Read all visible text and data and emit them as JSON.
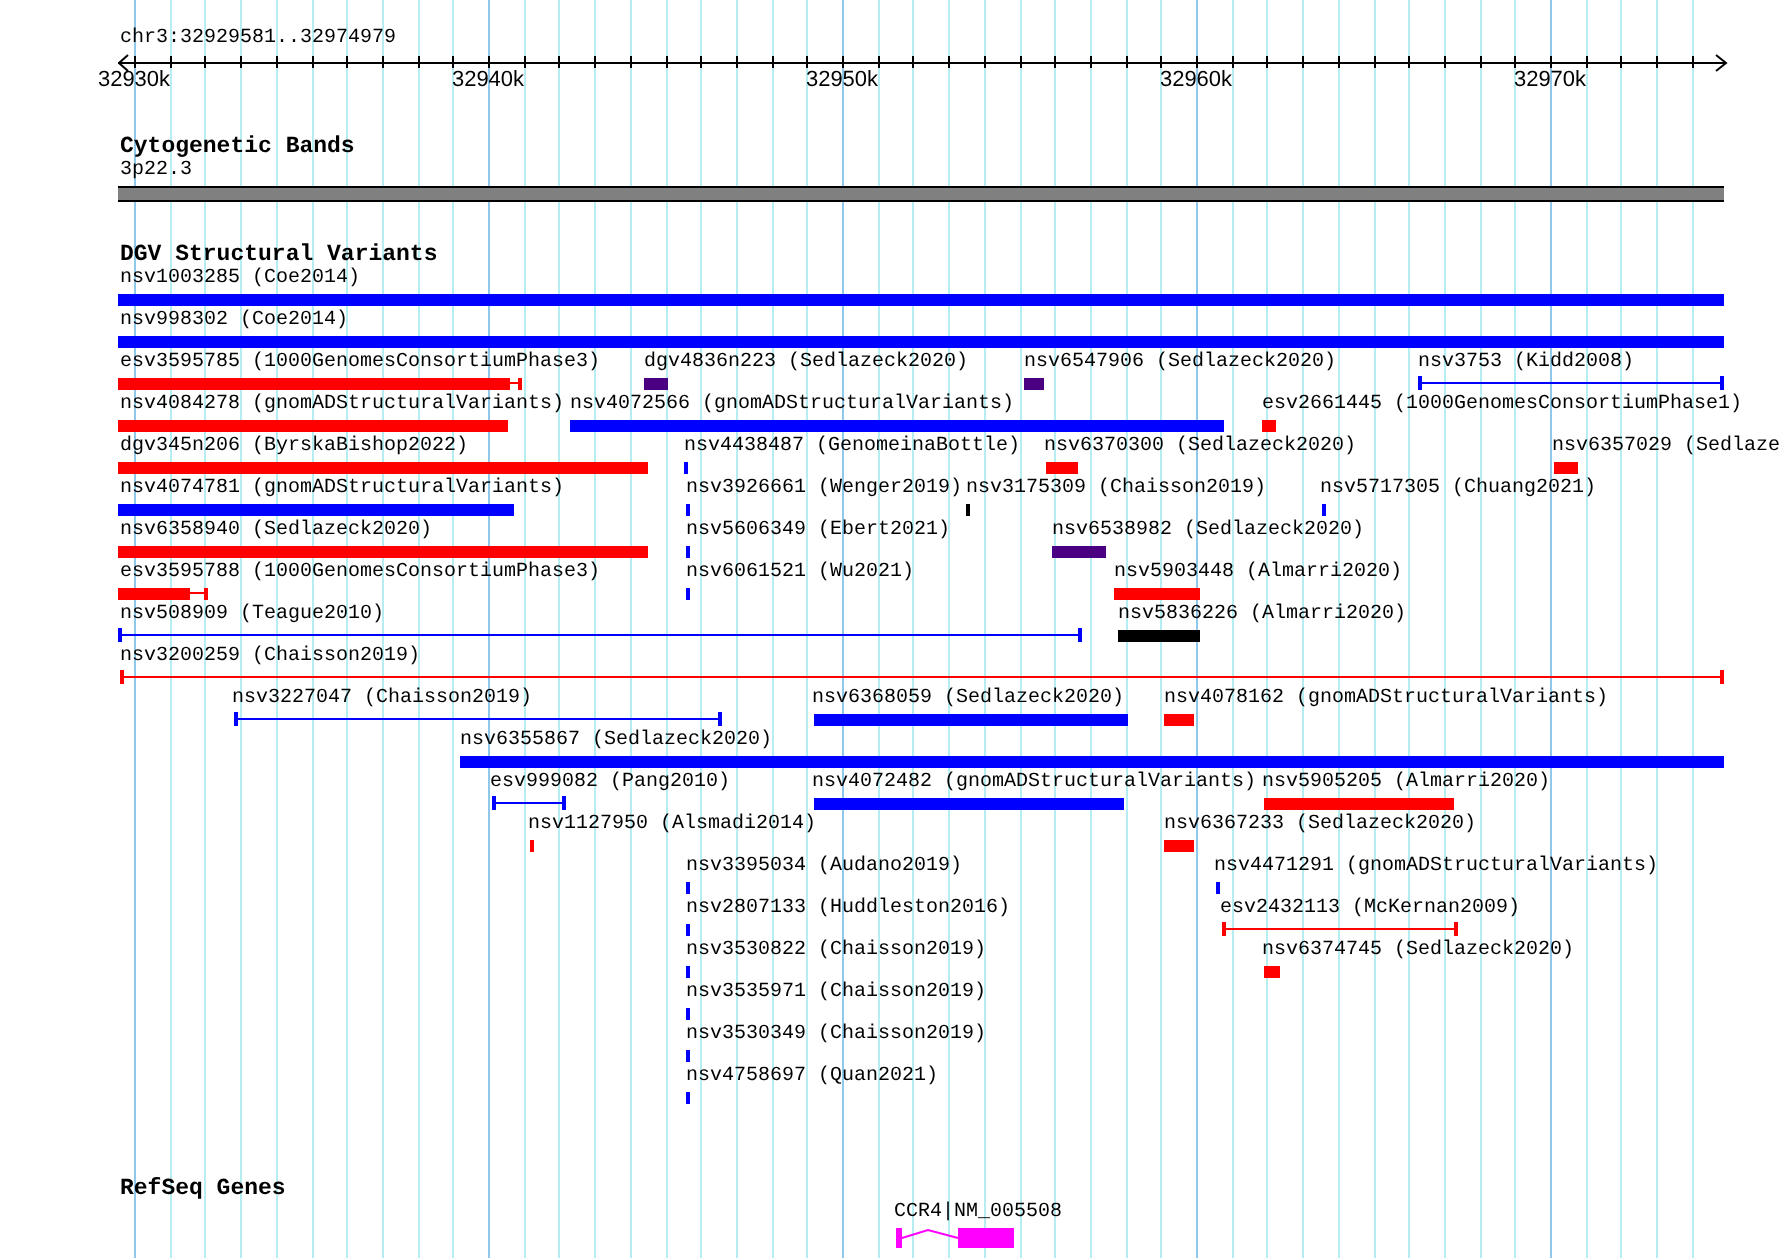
{
  "ruler": {
    "location": "chr3:32929581..32974979",
    "tick_labels": [
      "32930k",
      "32940k",
      "32950k",
      "32960k",
      "32970k"
    ]
  },
  "cytoband_track": {
    "title": "Cytogenetic Bands",
    "band_label": "3p22.3"
  },
  "variant_track": {
    "title": "DGV Structural Variants",
    "lanes": [
      {
        "features": [
          {
            "label": "nsv1003285 (Coe2014)",
            "color": "#0000ff",
            "kind": "bar"
          }
        ]
      },
      {
        "features": [
          {
            "label": "nsv998302 (Coe2014)",
            "color": "#0000ff",
            "kind": "bar"
          }
        ]
      },
      {
        "features": [
          {
            "label": "esv3595785 (1000GenomesConsortiumPhase3)",
            "color": "#ff0000",
            "kind": "bar_tail"
          },
          {
            "label": "dgv4836n223 (Sedlazeck2020)",
            "color": "#4b0082",
            "kind": "bar"
          },
          {
            "label": "nsv6547906 (Sedlazeck2020)",
            "color": "#4b0082",
            "kind": "bar"
          },
          {
            "label": "nsv3753 (Kidd2008)",
            "color": "#0000ff",
            "kind": "span"
          }
        ]
      },
      {
        "features": [
          {
            "label": "nsv4084278 (gnomADStructuralVariants)",
            "color": "#ff0000",
            "kind": "bar"
          },
          {
            "label": "nsv4072566 (gnomADStructuralVariants)",
            "color": "#0000ff",
            "kind": "bar"
          },
          {
            "label": "esv2661445 (1000GenomesConsortiumPhase1)",
            "color": "#ff0000",
            "kind": "bar"
          }
        ]
      },
      {
        "features": [
          {
            "label": "dgv345n206 (ByrskaBishop2022)",
            "color": "#ff0000",
            "kind": "bar"
          },
          {
            "label": "nsv4438487 (GenomeinaBottle)",
            "color": "#0000ff",
            "kind": "bar"
          },
          {
            "label": "nsv6370300 (Sedlazeck2020)",
            "color": "#ff0000",
            "kind": "bar"
          },
          {
            "label": "nsv6357029 (Sedlaze",
            "color": "#ff0000",
            "kind": "bar"
          }
        ]
      },
      {
        "features": [
          {
            "label": "nsv4074781 (gnomADStructuralVariants)",
            "color": "#0000ff",
            "kind": "bar"
          },
          {
            "label": "nsv3926661 (Wenger2019)",
            "color": "#0000ff",
            "kind": "bar"
          },
          {
            "label": "nsv3175309 (Chaisson2019)",
            "color": "#000000",
            "kind": "bar"
          },
          {
            "label": "nsv5717305 (Chuang2021)",
            "color": "#0000ff",
            "kind": "bar"
          }
        ]
      },
      {
        "features": [
          {
            "label": "nsv6358940 (Sedlazeck2020)",
            "color": "#ff0000",
            "kind": "bar"
          },
          {
            "label": "nsv5606349 (Ebert2021)",
            "color": "#0000ff",
            "kind": "bar"
          },
          {
            "label": "nsv6538982 (Sedlazeck2020)",
            "color": "#4b0082",
            "kind": "bar"
          }
        ]
      },
      {
        "features": [
          {
            "label": "esv3595788 (1000GenomesConsortiumPhase3)",
            "color": "#ff0000",
            "kind": "bar_tail"
          },
          {
            "label": "nsv6061521 (Wu2021)",
            "color": "#0000ff",
            "kind": "bar"
          },
          {
            "label": "nsv5903448 (Almarri2020)",
            "color": "#ff0000",
            "kind": "bar"
          }
        ]
      },
      {
        "features": [
          {
            "label": "nsv508909 (Teague2010)",
            "color": "#0000ff",
            "kind": "span"
          },
          {
            "label": "nsv5836226 (Almarri2020)",
            "color": "#000000",
            "kind": "bar"
          }
        ]
      },
      {
        "features": [
          {
            "label": "nsv3200259 (Chaisson2019)",
            "color": "#ff0000",
            "kind": "span"
          }
        ]
      },
      {
        "features": [
          {
            "label": "nsv3227047 (Chaisson2019)",
            "color": "#0000ff",
            "kind": "span"
          },
          {
            "label": "nsv6368059 (Sedlazeck2020)",
            "color": "#0000ff",
            "kind": "bar"
          },
          {
            "label": "nsv4078162 (gnomADStructuralVariants)",
            "color": "#ff0000",
            "kind": "bar"
          }
        ]
      },
      {
        "features": [
          {
            "label": "nsv6355867 (Sedlazeck2020)",
            "color": "#0000ff",
            "kind": "bar"
          }
        ]
      },
      {
        "features": [
          {
            "label": "esv999082 (Pang2010)",
            "color": "#0000ff",
            "kind": "span"
          },
          {
            "label": "nsv4072482 (gnomADStructuralVariants)",
            "color": "#0000ff",
            "kind": "bar"
          },
          {
            "label": "nsv5905205 (Almarri2020)",
            "color": "#ff0000",
            "kind": "bar"
          }
        ]
      },
      {
        "features": [
          {
            "label": "nsv1127950 (Alsmadi2014)",
            "color": "#ff0000",
            "kind": "bar"
          },
          {
            "label": "nsv6367233 (Sedlazeck2020)",
            "color": "#ff0000",
            "kind": "bar"
          }
        ]
      },
      {
        "features": [
          {
            "label": "nsv3395034 (Audano2019)",
            "color": "#0000ff",
            "kind": "bar"
          },
          {
            "label": "nsv4471291 (gnomADStructuralVariants)",
            "color": "#0000ff",
            "kind": "bar"
          }
        ]
      },
      {
        "features": [
          {
            "label": "nsv2807133 (Huddleston2016)",
            "color": "#0000ff",
            "kind": "bar"
          },
          {
            "label": "esv2432113 (McKernan2009)",
            "color": "#ff0000",
            "kind": "span"
          }
        ]
      },
      {
        "features": [
          {
            "label": "nsv3530822 (Chaisson2019)",
            "color": "#0000ff",
            "kind": "bar"
          },
          {
            "label": "nsv6374745 (Sedlazeck2020)",
            "color": "#ff0000",
            "kind": "bar"
          }
        ]
      },
      {
        "features": [
          {
            "label": "nsv3535971 (Chaisson2019)",
            "color": "#0000ff",
            "kind": "bar"
          }
        ]
      },
      {
        "features": [
          {
            "label": "nsv3530349 (Chaisson2019)",
            "color": "#0000ff",
            "kind": "bar"
          }
        ]
      },
      {
        "features": [
          {
            "label": "nsv4758697 (Quan2021)",
            "color": "#0000ff",
            "kind": "bar"
          }
        ]
      }
    ]
  },
  "gene_track": {
    "title": "RefSeq Genes",
    "genes": [
      {
        "label": "CCR4|NM_005508"
      }
    ]
  }
}
